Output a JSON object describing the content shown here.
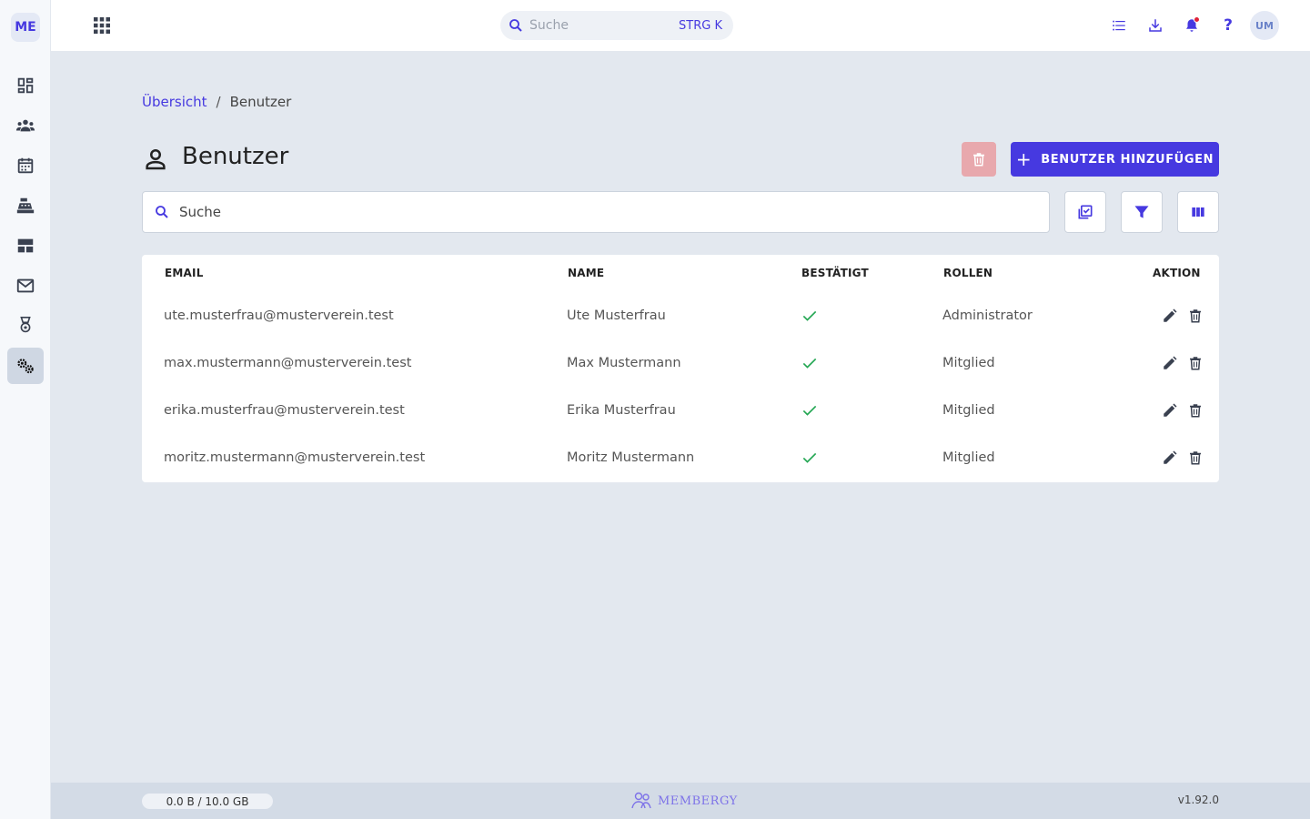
{
  "app": {
    "logo_text": "ME",
    "brand_name": "MEMBERGY",
    "version": "v1.92.0",
    "storage": "0.0 B / 10.0 GB",
    "accent_color": "#4639e0"
  },
  "sidebar": {
    "items": [
      {
        "name": "dashboard",
        "icon": "dashboard-icon",
        "active": false
      },
      {
        "name": "members",
        "icon": "people-icon",
        "active": false
      },
      {
        "name": "calendar",
        "icon": "calendar-icon",
        "active": false
      },
      {
        "name": "cash-register",
        "icon": "cash-register-icon",
        "active": false
      },
      {
        "name": "layout",
        "icon": "layout-icon",
        "active": false
      },
      {
        "name": "mail",
        "icon": "mail-icon",
        "active": false
      },
      {
        "name": "awards",
        "icon": "badge-icon",
        "active": false
      },
      {
        "name": "settings",
        "icon": "gears-icon",
        "active": true
      }
    ]
  },
  "topbar": {
    "search_placeholder": "Suche",
    "search_shortcut": "STRG K",
    "help_label": "?",
    "avatar_initials": "UM"
  },
  "breadcrumb": {
    "parent": "Übersicht",
    "separator": "/",
    "current": "Benutzer"
  },
  "page": {
    "title": "Benutzer",
    "add_button": "BENUTZER HINZUFÜGEN",
    "add_button_icon": "+",
    "search_placeholder": "Suche"
  },
  "table": {
    "columns": [
      "EMAIL",
      "NAME",
      "BESTÄTIGT",
      "ROLLEN",
      "AKTION"
    ],
    "rows": [
      {
        "email": "ute.musterfrau@musterverein.test",
        "name": "Ute Musterfrau",
        "confirmed": true,
        "role": "Administrator"
      },
      {
        "email": "max.mustermann@musterverein.test",
        "name": "Max Mustermann",
        "confirmed": true,
        "role": "Mitglied"
      },
      {
        "email": "erika.musterfrau@musterverein.test",
        "name": "Erika Musterfrau",
        "confirmed": true,
        "role": "Mitglied"
      },
      {
        "email": "moritz.mustermann@musterverein.test",
        "name": "Moritz Mustermann",
        "confirmed": true,
        "role": "Mitglied"
      }
    ]
  }
}
